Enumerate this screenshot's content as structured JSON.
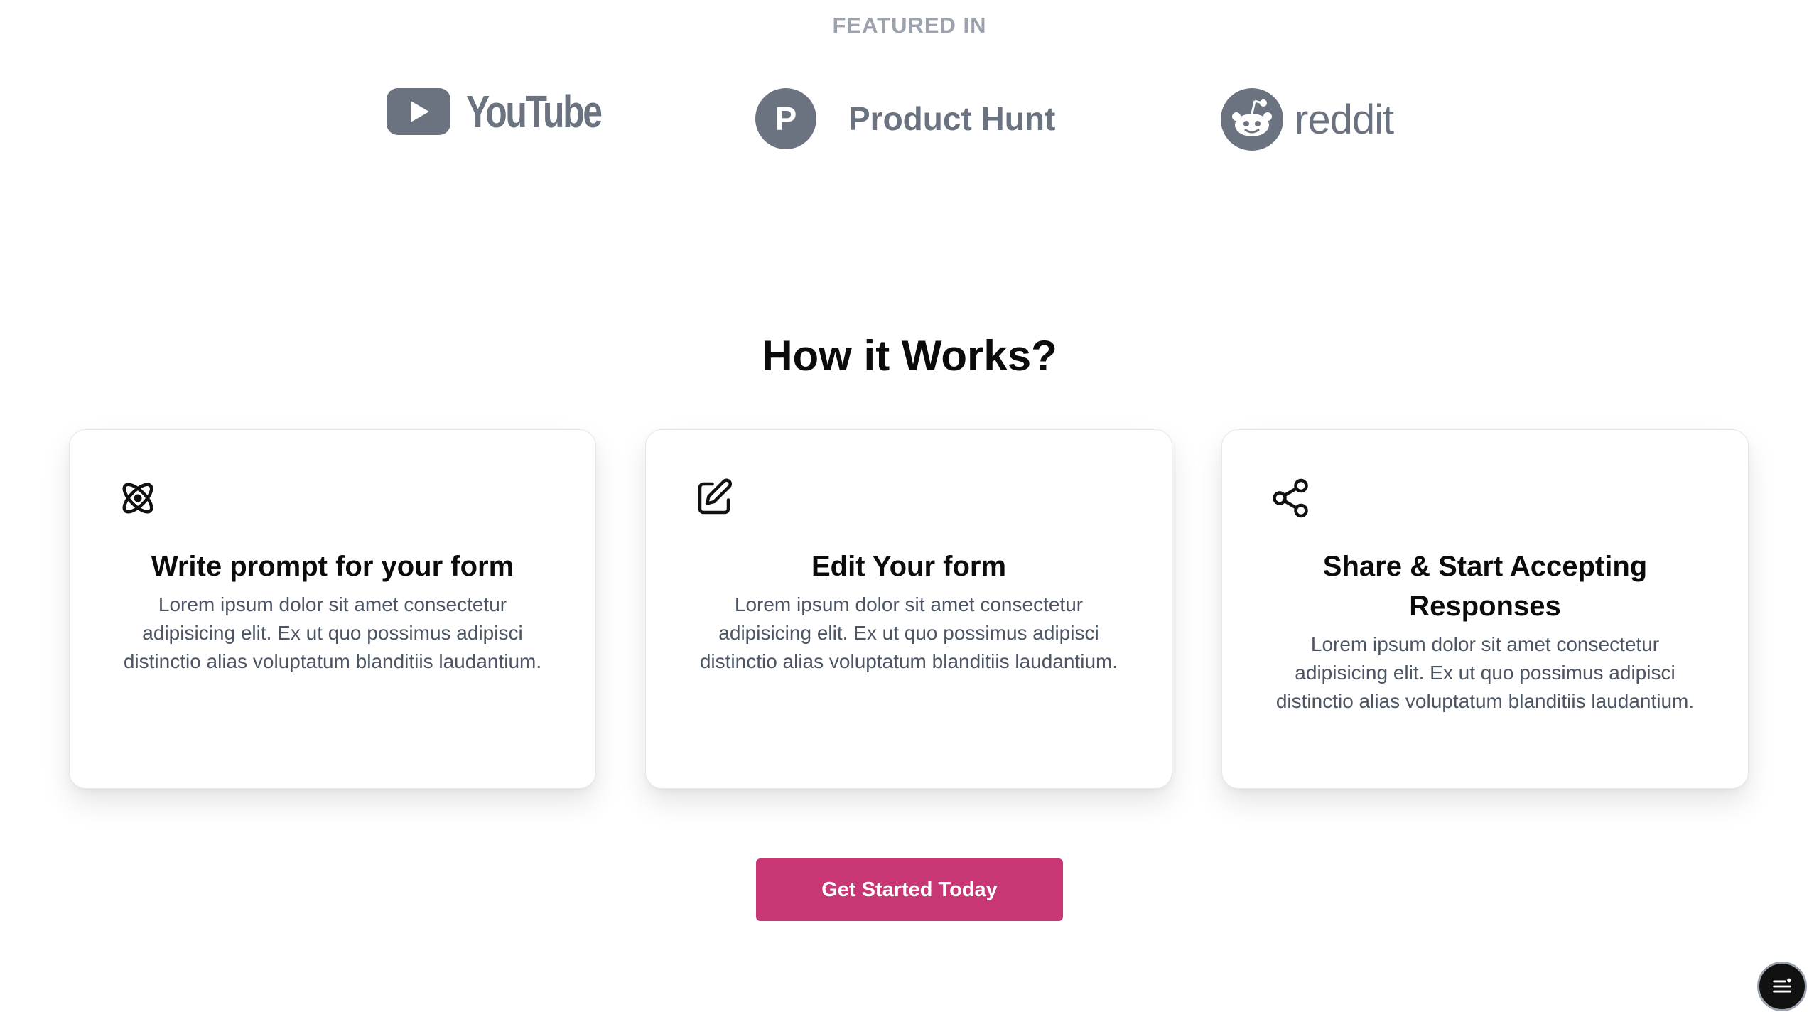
{
  "featured": {
    "label": "FEATURED IN",
    "logos": [
      {
        "name": "YouTube",
        "icon": "youtube-play-icon"
      },
      {
        "name": "Product Hunt",
        "icon_letter": "P",
        "icon": "product-hunt-icon"
      },
      {
        "name": "reddit",
        "icon": "reddit-alien-icon"
      }
    ]
  },
  "how_it_works": {
    "title": "How it Works?",
    "cards": [
      {
        "icon": "atom-icon",
        "title": "Write prompt for your form",
        "body": "Lorem ipsum dolor sit amet consectetur adipisicing elit. Ex ut quo possimus adipisci distinctio alias voluptatum blanditiis laudantium."
      },
      {
        "icon": "edit-icon",
        "title": "Edit Your form",
        "body": "Lorem ipsum dolor sit amet consectetur adipisicing elit. Ex ut quo possimus adipisci distinctio alias voluptatum blanditiis laudantium."
      },
      {
        "icon": "share-icon",
        "title": "Share & Start Accepting Responses",
        "body": "Lorem ipsum dolor sit amet consectetur adipisicing elit. Ex ut quo possimus adipisci distinctio alias voluptatum blanditiis laudantium."
      }
    ]
  },
  "cta": {
    "label": "Get Started Today"
  },
  "colors": {
    "accent": "#c83774",
    "logo_gray": "#6b7280",
    "muted": "#9ca3af"
  },
  "floating_menu": {
    "icon": "menu-icon"
  }
}
